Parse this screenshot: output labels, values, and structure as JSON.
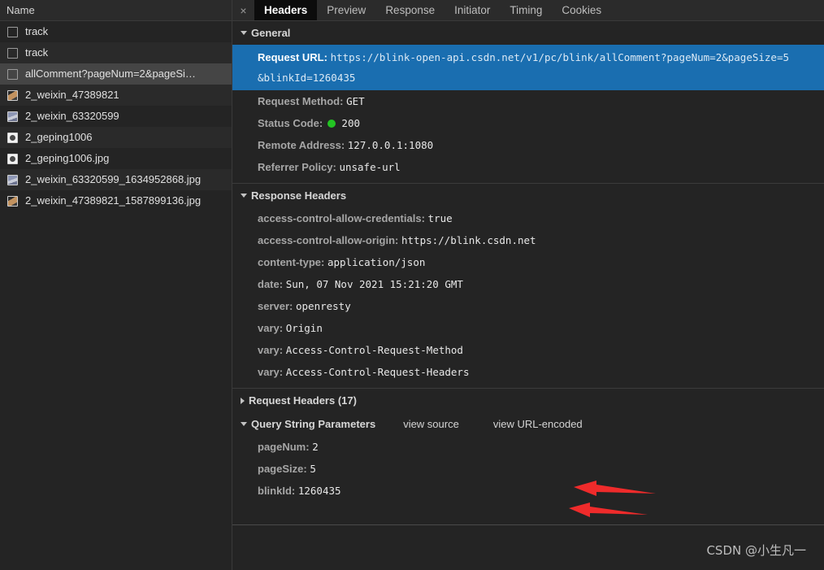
{
  "sidebar": {
    "column_header": "Name",
    "rows": [
      {
        "name": "track",
        "icon": "document-icon",
        "selected": false
      },
      {
        "name": "track",
        "icon": "document-icon",
        "selected": false
      },
      {
        "name": "allComment?pageNum=2&pageSi…",
        "icon": "document-icon",
        "selected": true
      },
      {
        "name": "2_weixin_47389821",
        "icon": "image-thumbnail-icon",
        "selected": false
      },
      {
        "name": "2_weixin_63320599",
        "icon": "image-thumbnail-icon",
        "selected": false
      },
      {
        "name": "2_geping1006",
        "icon": "image-thumbnail-icon",
        "selected": false
      },
      {
        "name": "2_geping1006.jpg",
        "icon": "image-thumbnail-icon",
        "selected": false
      },
      {
        "name": "2_weixin_63320599_1634952868.jpg",
        "icon": "image-thumbnail-icon",
        "selected": false
      },
      {
        "name": "2_weixin_47389821_1587899136.jpg",
        "icon": "image-thumbnail-icon",
        "selected": false
      }
    ]
  },
  "tabs": {
    "close_label": "×",
    "items": [
      {
        "label": "Headers",
        "active": true
      },
      {
        "label": "Preview",
        "active": false
      },
      {
        "label": "Response",
        "active": false
      },
      {
        "label": "Initiator",
        "active": false
      },
      {
        "label": "Timing",
        "active": false
      },
      {
        "label": "Cookies",
        "active": false
      }
    ]
  },
  "general": {
    "title": "General",
    "request_url_key": "Request URL:",
    "request_url_line1": "https://blink-open-api.csdn.net/v1/pc/blink/allComment?pageNum=2&pageSize=5",
    "request_url_line2": "&blinkId=1260435",
    "request_method_key": "Request Method:",
    "request_method_value": "GET",
    "status_code_key": "Status Code:",
    "status_code_value": "200",
    "remote_address_key": "Remote Address:",
    "remote_address_value": "127.0.0.1:1080",
    "referrer_policy_key": "Referrer Policy:",
    "referrer_policy_value": "unsafe-url"
  },
  "response_headers": {
    "title": "Response Headers",
    "entries": [
      {
        "key": "access-control-allow-credentials:",
        "value": "true"
      },
      {
        "key": "access-control-allow-origin:",
        "value": "https://blink.csdn.net"
      },
      {
        "key": "content-type:",
        "value": "application/json"
      },
      {
        "key": "date:",
        "value": "Sun, 07 Nov 2021 15:21:20 GMT"
      },
      {
        "key": "server:",
        "value": "openresty"
      },
      {
        "key": "vary:",
        "value": "Origin"
      },
      {
        "key": "vary:",
        "value": "Access-Control-Request-Method"
      },
      {
        "key": "vary:",
        "value": "Access-Control-Request-Headers"
      }
    ]
  },
  "request_headers": {
    "title": "Request Headers (17)",
    "count": 17,
    "collapsed": true
  },
  "query_string_parameters": {
    "title": "Query String Parameters",
    "view_source_label": "view source",
    "view_url_encoded_label": "view URL-encoded",
    "entries": [
      {
        "key": "pageNum:",
        "value": "2"
      },
      {
        "key": "pageSize:",
        "value": "5"
      },
      {
        "key": "blinkId:",
        "value": "1260435"
      }
    ]
  },
  "annotations": {
    "arrow_color": "#ef2b2b",
    "arrows": [
      {
        "name": "arrow-pagenum"
      },
      {
        "name": "arrow-pagesize"
      },
      {
        "name": "arrow-blinkid"
      }
    ]
  },
  "watermark": {
    "text": "CSDN @小生凡一"
  },
  "colors": {
    "panel_bg": "#242424",
    "row_alt_bg": "#2a2a2a",
    "selected_row_bg": "#454545",
    "highlight_blue": "#1a6eb0",
    "status_green": "#23c423",
    "accent_red": "#ef2b2b"
  }
}
